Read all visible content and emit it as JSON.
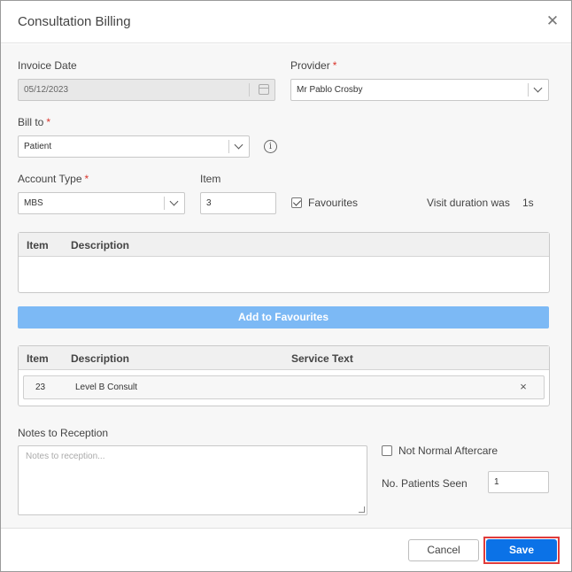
{
  "dialog": {
    "title": "Consultation Billing",
    "close_icon": "close-icon"
  },
  "form": {
    "invoice_date_label": "Invoice Date",
    "invoice_date_value": "05/12/2023",
    "provider_label": "Provider",
    "provider_value": "Mr Pablo Crosby",
    "bill_to_label": "Bill to",
    "bill_to_value": "Patient",
    "account_type_label": "Account Type",
    "account_type_value": "MBS",
    "item_label": "Item",
    "item_value": "3",
    "favourites_label": "Favourites",
    "favourites_checked": true,
    "visit_duration_label": "Visit duration was",
    "visit_duration_value": "1s",
    "required_marker": "*"
  },
  "search_table": {
    "columns": [
      "Item",
      "Description"
    ]
  },
  "add_to_favourites_label": "Add to Favourites",
  "selected_table": {
    "columns": [
      "Item",
      "Description",
      "Service Text"
    ],
    "rows": [
      {
        "item": "23",
        "description": "Level B Consult",
        "service_text": ""
      }
    ]
  },
  "notes": {
    "label": "Notes to Reception",
    "placeholder": "Notes to reception..."
  },
  "not_normal_aftercare_label": "Not Normal Aftercare",
  "no_patients_seen_label": "No. Patients Seen",
  "no_patients_seen_value": "1",
  "footer": {
    "cancel_label": "Cancel",
    "save_label": "Save"
  },
  "colors": {
    "primary": "#0b72e7",
    "favourites_button": "#7cb9f5",
    "required": "#d9342b",
    "highlight_outline": "#e03c3c"
  }
}
